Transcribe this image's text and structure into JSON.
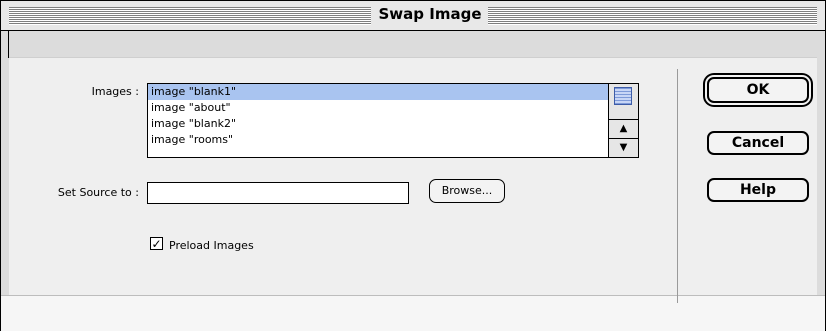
{
  "window": {
    "title": "Swap Image"
  },
  "form": {
    "images_label": "Images :",
    "images": [
      {
        "label": "image \"blank1\"",
        "selected": true
      },
      {
        "label": "image \"about\"",
        "selected": false
      },
      {
        "label": "image \"blank2\"",
        "selected": false
      },
      {
        "label": "image \"rooms\"",
        "selected": false
      }
    ],
    "source_label": "Set Source to :",
    "source_value": "",
    "browse_label": "Browse...",
    "preload_label": "Preload Images",
    "preload_checked": true,
    "checkmark": "✓"
  },
  "buttons": {
    "ok": "OK",
    "cancel": "Cancel",
    "help": "Help"
  },
  "icons": {
    "scroll_up": "▲",
    "scroll_down": "▼"
  }
}
